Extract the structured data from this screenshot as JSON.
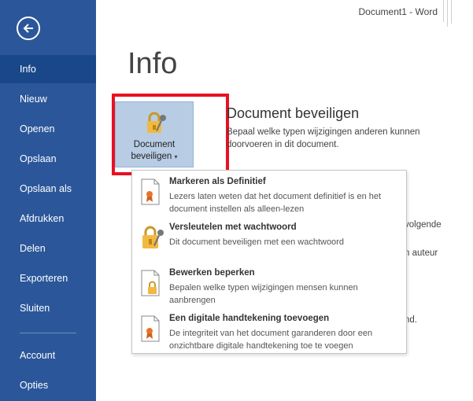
{
  "window": {
    "title": "Document1 - Word"
  },
  "sidebar": {
    "items": [
      {
        "label": "Info",
        "active": true
      },
      {
        "label": "Nieuw"
      },
      {
        "label": "Openen"
      },
      {
        "label": "Opslaan"
      },
      {
        "label": "Opslaan als"
      },
      {
        "label": "Afdrukken"
      },
      {
        "label": "Delen"
      },
      {
        "label": "Exporteren"
      },
      {
        "label": "Sluiten"
      }
    ],
    "bottom_items": [
      {
        "label": "Account"
      },
      {
        "label": "Opties"
      }
    ]
  },
  "main": {
    "page_title": "Info",
    "protect_button": {
      "line1": "Document",
      "line2": "beveiligen"
    },
    "section": {
      "title": "Document beveiligen",
      "description": "Bepaal welke typen wijzigingen anderen kunnen doorvoeren in dit document."
    },
    "background_fragments": [
      "volgende",
      "n auteur",
      "nd."
    ]
  },
  "dropdown": {
    "items": [
      {
        "title": "Markeren als Definitief",
        "description": "Lezers laten weten dat het document definitief is en het document instellen als alleen-lezen",
        "icon": "document-ribbon-icon"
      },
      {
        "title": "Versleutelen met wachtwoord",
        "description": "Dit document beveiligen met een wachtwoord",
        "icon": "lock-key-icon"
      },
      {
        "title": "Bewerken beperken",
        "description": "Bepalen welke typen wijzigingen mensen kunnen aanbrengen",
        "icon": "document-lock-icon"
      },
      {
        "title": "Een digitale handtekening toevoegen",
        "description": "De integriteit van het document garanderen door een onzichtbare digitale handtekening toe te voegen",
        "icon": "document-ribbon-icon"
      }
    ]
  },
  "colors": {
    "sidebar": "#2b579a",
    "sidebar_active": "#19478a",
    "highlight_border": "#e81123",
    "button_bg": "#b8cce4"
  }
}
